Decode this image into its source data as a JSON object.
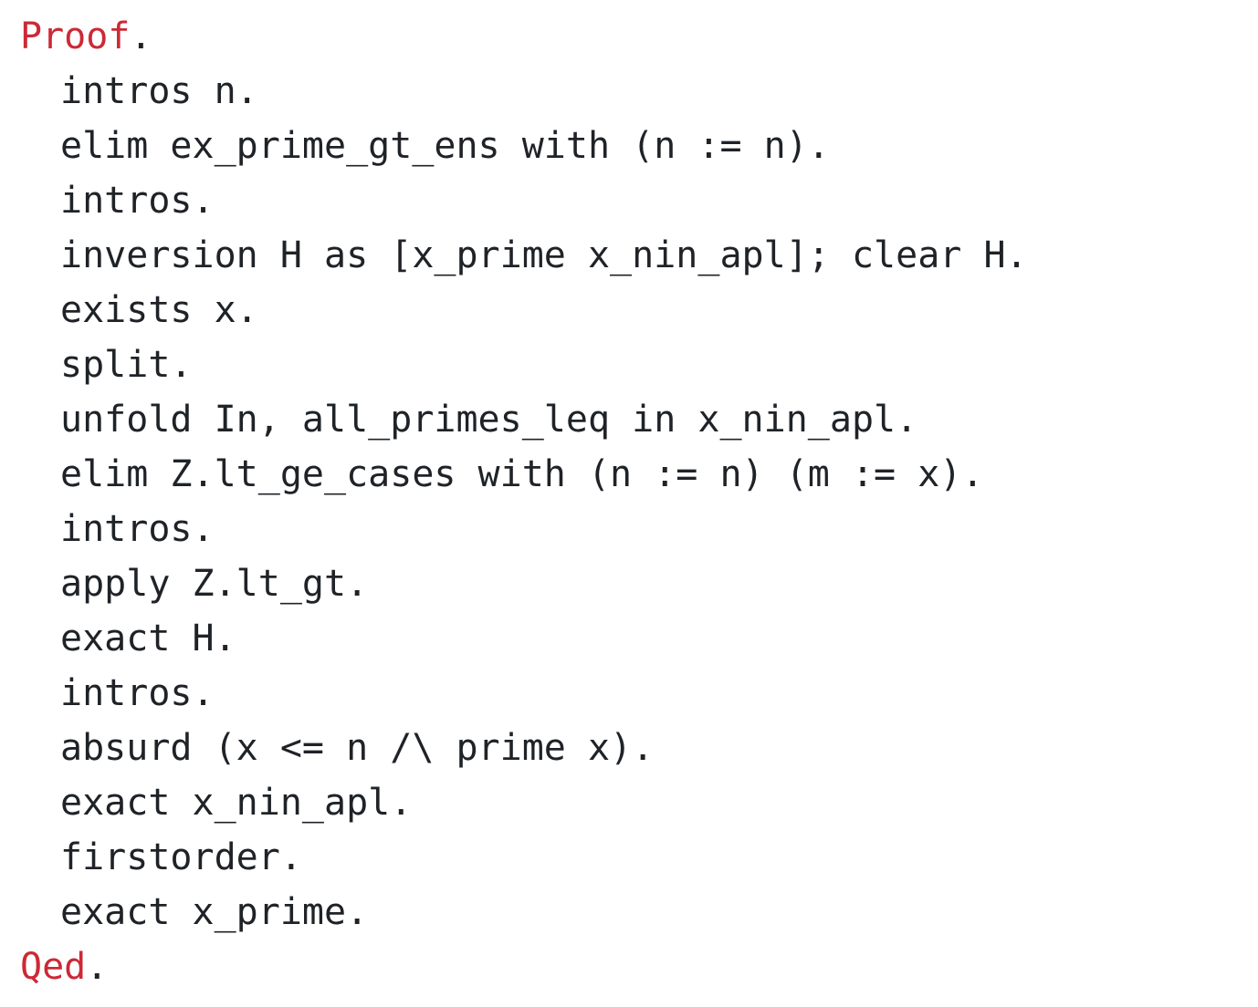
{
  "document": {
    "kind": "coq-proof-script",
    "background_color": "#ffffff",
    "text_color": "#1f2328",
    "keyword_color": "#cc2936",
    "lines": [
      {
        "indent": 0,
        "keyword": "Proof",
        "text": ".",
        "full_text": "Proof."
      },
      {
        "indent": 1,
        "keyword": "",
        "text": "intros n.",
        "full_text": "intros n."
      },
      {
        "indent": 1,
        "keyword": "",
        "text": "elim ex_prime_gt_ens with (n := n).",
        "full_text": "elim ex_prime_gt_ens with (n := n)."
      },
      {
        "indent": 1,
        "keyword": "",
        "text": "intros.",
        "full_text": "intros."
      },
      {
        "indent": 1,
        "keyword": "",
        "text": "inversion H as [x_prime x_nin_apl]; clear H.",
        "full_text": "inversion H as [x_prime x_nin_apl]; clear H."
      },
      {
        "indent": 1,
        "keyword": "",
        "text": "exists x.",
        "full_text": "exists x."
      },
      {
        "indent": 1,
        "keyword": "",
        "text": "split.",
        "full_text": "split."
      },
      {
        "indent": 1,
        "keyword": "",
        "text": "unfold In, all_primes_leq in x_nin_apl.",
        "full_text": "unfold In, all_primes_leq in x_nin_apl."
      },
      {
        "indent": 1,
        "keyword": "",
        "text": "elim Z.lt_ge_cases with (n := n) (m := x).",
        "full_text": "elim Z.lt_ge_cases with (n := n) (m := x)."
      },
      {
        "indent": 1,
        "keyword": "",
        "text": "intros.",
        "full_text": "intros."
      },
      {
        "indent": 1,
        "keyword": "",
        "text": "apply Z.lt_gt.",
        "full_text": "apply Z.lt_gt."
      },
      {
        "indent": 1,
        "keyword": "",
        "text": "exact H.",
        "full_text": "exact H."
      },
      {
        "indent": 1,
        "keyword": "",
        "text": "intros.",
        "full_text": "intros."
      },
      {
        "indent": 1,
        "keyword": "",
        "text": "absurd (x <= n /\\ prime x).",
        "full_text": "absurd (x <= n /\\ prime x)."
      },
      {
        "indent": 1,
        "keyword": "",
        "text": "exact x_nin_apl.",
        "full_text": "exact x_nin_apl."
      },
      {
        "indent": 1,
        "keyword": "",
        "text": "firstorder.",
        "full_text": "firstorder."
      },
      {
        "indent": 1,
        "keyword": "",
        "text": "exact x_prime.",
        "full_text": "exact x_prime."
      },
      {
        "indent": 0,
        "keyword": "Qed",
        "text": ".",
        "full_text": "Qed."
      }
    ]
  }
}
